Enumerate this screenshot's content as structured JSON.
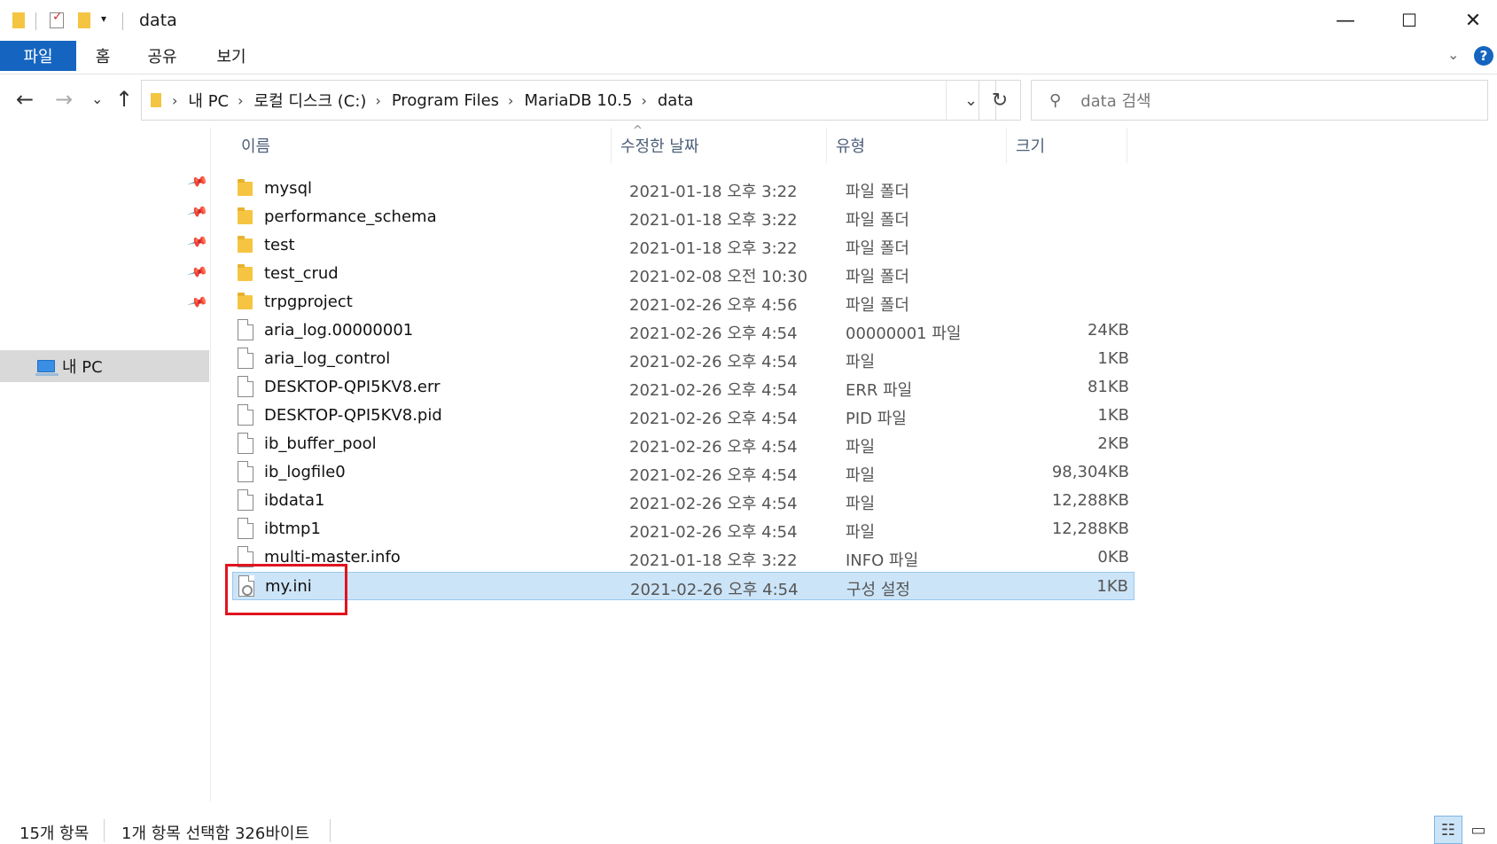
{
  "window": {
    "title": "data",
    "minimize": "—",
    "maximize": "☐",
    "close": "✕"
  },
  "ribbon": {
    "tabs": [
      "파일",
      "홈",
      "공유",
      "보기"
    ],
    "active_tab": "파일",
    "expand_icon": "⌄",
    "help": "?"
  },
  "nav": {
    "back": "←",
    "forward": "→",
    "recent": "⌄",
    "up": "↑",
    "breadcrumb": [
      "내 PC",
      "로컬 디스크 (C:)",
      "Program Files",
      "MariaDB 10.5",
      "data"
    ],
    "refresh": "↻",
    "search_placeholder": "data 검색"
  },
  "navpane": {
    "pc_label": "내 PC"
  },
  "columns": {
    "name": "이름",
    "date": "수정한 날짜",
    "type": "유형",
    "size": "크기"
  },
  "files": [
    {
      "name": "mysql",
      "date": "2021-01-18 오후 3:22",
      "type": "파일 폴더",
      "size": "",
      "kind": "folder"
    },
    {
      "name": "performance_schema",
      "date": "2021-01-18 오후 3:22",
      "type": "파일 폴더",
      "size": "",
      "kind": "folder"
    },
    {
      "name": "test",
      "date": "2021-01-18 오후 3:22",
      "type": "파일 폴더",
      "size": "",
      "kind": "folder"
    },
    {
      "name": "test_crud",
      "date": "2021-02-08 오전 10:30",
      "type": "파일 폴더",
      "size": "",
      "kind": "folder"
    },
    {
      "name": "trpgproject",
      "date": "2021-02-26 오후 4:56",
      "type": "파일 폴더",
      "size": "",
      "kind": "folder"
    },
    {
      "name": "aria_log.00000001",
      "date": "2021-02-26 오후 4:54",
      "type": "00000001 파일",
      "size": "24KB",
      "kind": "file"
    },
    {
      "name": "aria_log_control",
      "date": "2021-02-26 오후 4:54",
      "type": "파일",
      "size": "1KB",
      "kind": "file"
    },
    {
      "name": "DESKTOP-QPI5KV8.err",
      "date": "2021-02-26 오후 4:54",
      "type": "ERR 파일",
      "size": "81KB",
      "kind": "file"
    },
    {
      "name": "DESKTOP-QPI5KV8.pid",
      "date": "2021-02-26 오후 4:54",
      "type": "PID 파일",
      "size": "1KB",
      "kind": "file"
    },
    {
      "name": "ib_buffer_pool",
      "date": "2021-02-26 오후 4:54",
      "type": "파일",
      "size": "2KB",
      "kind": "file"
    },
    {
      "name": "ib_logfile0",
      "date": "2021-02-26 오후 4:54",
      "type": "파일",
      "size": "98,304KB",
      "kind": "file"
    },
    {
      "name": "ibdata1",
      "date": "2021-02-26 오후 4:54",
      "type": "파일",
      "size": "12,288KB",
      "kind": "file"
    },
    {
      "name": "ibtmp1",
      "date": "2021-02-26 오후 4:54",
      "type": "파일",
      "size": "12,288KB",
      "kind": "file"
    },
    {
      "name": "multi-master.info",
      "date": "2021-01-18 오후 3:22",
      "type": "INFO 파일",
      "size": "0KB",
      "kind": "file"
    },
    {
      "name": "my.ini",
      "date": "2021-02-26 오후 4:54",
      "type": "구성 설정",
      "size": "1KB",
      "kind": "config",
      "selected": true
    }
  ],
  "status": {
    "count": "15개 항목",
    "selection": "1개 항목 선택함 326바이트"
  },
  "colors": {
    "accent": "#1565c0",
    "selection": "#cce4f7",
    "highlight_box": "#e0141e"
  }
}
